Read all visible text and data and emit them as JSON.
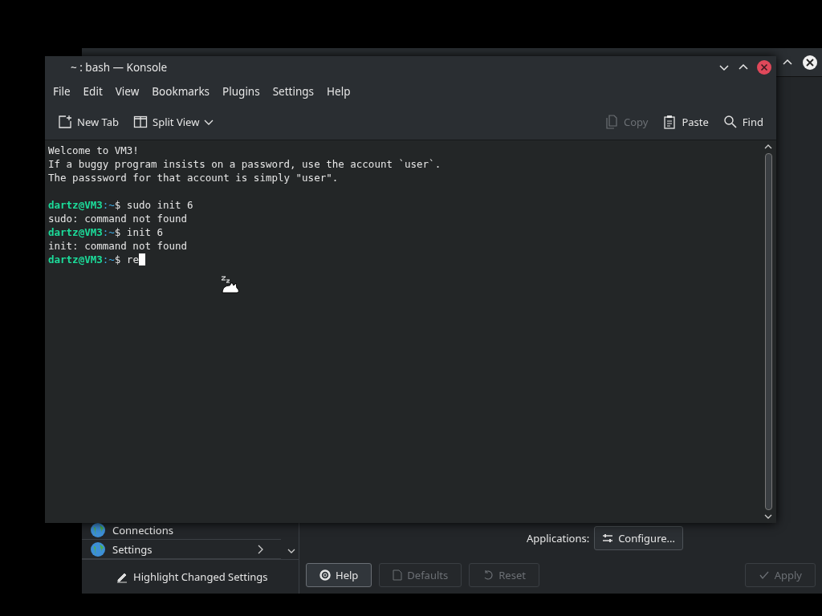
{
  "konsole": {
    "title": "~ : bash — Konsole",
    "menu": [
      "File",
      "Edit",
      "View",
      "Bookmarks",
      "Plugins",
      "Settings",
      "Help"
    ],
    "toolbar": [
      {
        "label": "New Tab",
        "kind": "newtab",
        "disabled": false
      },
      {
        "label": "Split View",
        "kind": "split",
        "disabled": false
      },
      {
        "label": "Copy",
        "kind": "copy",
        "disabled": true
      },
      {
        "label": "Paste",
        "kind": "paste",
        "disabled": false
      },
      {
        "label": "Find",
        "kind": "find",
        "disabled": false
      }
    ],
    "terminal": [
      {
        "kind": "output",
        "text": "Welcome to VM3!"
      },
      {
        "kind": "output",
        "text": "If a buggy program insists on a password, use the account `user`."
      },
      {
        "kind": "output",
        "text": "The passsword for that account is simply \"user\"."
      },
      {
        "kind": "blank"
      },
      {
        "kind": "prompt",
        "user_host": "dartz@VM3",
        "path": ":~",
        "symbol": "$",
        "command": "sudo init 6",
        "cursor": false
      },
      {
        "kind": "output",
        "text": "sudo: command not found"
      },
      {
        "kind": "prompt",
        "user_host": "dartz@VM3",
        "path": ":~",
        "symbol": "$",
        "command": "init 6",
        "cursor": false
      },
      {
        "kind": "output",
        "text": "init: command not found"
      },
      {
        "kind": "prompt",
        "user_host": "dartz@VM3",
        "path": ":~",
        "symbol": "$",
        "command": "re",
        "cursor": true
      }
    ]
  },
  "settings": {
    "sidebar": [
      {
        "label": "Connections",
        "arrow": false
      },
      {
        "label": "Settings",
        "arrow": true
      }
    ],
    "applications_label": "Applications:",
    "configure_button": "Configure...",
    "highlight_button": "Highlight Changed Settings",
    "buttons": [
      {
        "label": "Help",
        "kind": "help",
        "disabled": false
      },
      {
        "label": "Defaults",
        "kind": "defaults",
        "disabled": true
      },
      {
        "label": "Reset",
        "kind": "reset",
        "disabled": true
      },
      {
        "label": "Apply",
        "kind": "apply",
        "disabled": true
      }
    ]
  }
}
